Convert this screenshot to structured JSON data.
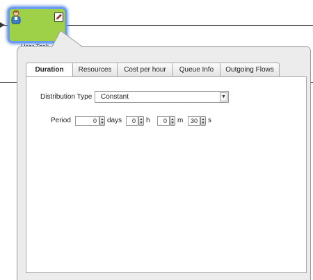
{
  "diagram": {
    "task_icon": "person-icon",
    "edit_icon": "pencil-icon",
    "task_name": "User Task"
  },
  "tabs": [
    {
      "label": "Duration",
      "active": true
    },
    {
      "label": "Resources",
      "active": false
    },
    {
      "label": "Cost per hour",
      "active": false
    },
    {
      "label": "Queue Info",
      "active": false
    },
    {
      "label": "Outgoing Flows",
      "active": false
    }
  ],
  "duration": {
    "distribution_type_label": "Distribution Type",
    "distribution_type_value": "Constant",
    "period_label": "Period",
    "days_value": "0",
    "days_unit": "days",
    "hours_value": "0",
    "hours_unit": "h",
    "minutes_value": "0",
    "minutes_unit": "m",
    "seconds_value": "30",
    "seconds_unit": "s"
  },
  "colors": {
    "task_fill": "#9ed048",
    "task_highlight": "#6a9bf2"
  }
}
